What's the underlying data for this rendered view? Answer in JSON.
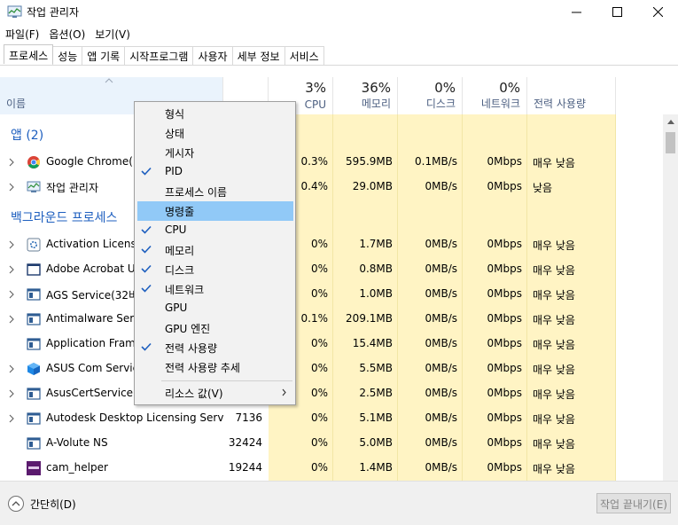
{
  "window": {
    "title": "작업 관리자"
  },
  "menu": [
    "파일(F)",
    "옵션(O)",
    "보기(V)"
  ],
  "tabs": [
    "프로세스",
    "성능",
    "앱 기록",
    "시작프로그램",
    "사용자",
    "세부 정보",
    "서비스"
  ],
  "columns": {
    "name": {
      "label": "이름"
    },
    "cpu": {
      "percent": "3%",
      "label": "CPU"
    },
    "memory": {
      "percent": "36%",
      "label": "메모리"
    },
    "disk": {
      "percent": "0%",
      "label": "디스크"
    },
    "network": {
      "percent": "0%",
      "label": "네트워크"
    },
    "power": {
      "label": "전력 사용량"
    }
  },
  "groups": {
    "apps": "앱 (2)",
    "background": "백그라운드 프로세스"
  },
  "rows": [
    {
      "name": "Google Chrome(14",
      "icon": "chrome-icon",
      "pid": "",
      "cpu": "0.3%",
      "mem": "595.9MB",
      "disk": "0.1MB/s",
      "net": "0Mbps",
      "power": "매우 낮음"
    },
    {
      "name": "작업 관리자",
      "icon": "task-manager-icon",
      "pid": "",
      "cpu": "0.4%",
      "mem": "29.0MB",
      "disk": "0MB/s",
      "net": "0Mbps",
      "power": "낮음"
    },
    {
      "name": "Activation Licensin",
      "icon": "gear-app-icon",
      "pid": "",
      "cpu": "0%",
      "mem": "1.7MB",
      "disk": "0MB/s",
      "net": "0Mbps",
      "power": "매우 낮음"
    },
    {
      "name": "Adobe Acrobat Up",
      "icon": "window-icon",
      "pid": "",
      "cpu": "0%",
      "mem": "0.8MB",
      "disk": "0MB/s",
      "net": "0Mbps",
      "power": "매우 낮음"
    },
    {
      "name": "AGS Service(32비트",
      "icon": "service-icon",
      "pid": "",
      "cpu": "0%",
      "mem": "1.0MB",
      "disk": "0MB/s",
      "net": "0Mbps",
      "power": "매우 낮음"
    },
    {
      "name": "Antimalware Servic",
      "icon": "service-icon",
      "pid": "",
      "cpu": "0.1%",
      "mem": "209.1MB",
      "disk": "0MB/s",
      "net": "0Mbps",
      "power": "매우 낮음"
    },
    {
      "name": "Application Frame",
      "icon": "service-icon",
      "pid": "",
      "cpu": "0%",
      "mem": "15.4MB",
      "disk": "0MB/s",
      "net": "0Mbps",
      "power": "매우 낮음"
    },
    {
      "name": "ASUS Com Service",
      "icon": "cube-icon",
      "pid": "",
      "cpu": "0%",
      "mem": "5.5MB",
      "disk": "0MB/s",
      "net": "0Mbps",
      "power": "매우 낮음"
    },
    {
      "name": "AsusCertService.ex",
      "icon": "service-icon",
      "pid": "",
      "cpu": "0%",
      "mem": "2.5MB",
      "disk": "0MB/s",
      "net": "0Mbps",
      "power": "매우 낮음"
    },
    {
      "name": "Autodesk Desktop Licensing Servi...",
      "icon": "service-icon",
      "pid": "7136",
      "cpu": "0%",
      "mem": "5.1MB",
      "disk": "0MB/s",
      "net": "0Mbps",
      "power": "매우 낮음"
    },
    {
      "name": "A-Volute NS",
      "icon": "service-icon",
      "pid": "32424",
      "cpu": "0%",
      "mem": "5.0MB",
      "disk": "0MB/s",
      "net": "0Mbps",
      "power": "매우 낮음"
    },
    {
      "name": "cam_helper",
      "icon": "nzxt-icon",
      "pid": "19244",
      "cpu": "0%",
      "mem": "1.4MB",
      "disk": "0MB/s",
      "net": "0Mbps",
      "power": "매우 낮음"
    }
  ],
  "context_menu": {
    "items": [
      {
        "label": "형식",
        "checked": false
      },
      {
        "label": "상태",
        "checked": false
      },
      {
        "label": "게시자",
        "checked": false
      },
      {
        "label": "PID",
        "checked": true
      },
      {
        "label": "프로세스 이름",
        "checked": false
      },
      {
        "label": "명령줄",
        "checked": false,
        "highlighted": true
      },
      {
        "label": "CPU",
        "checked": true
      },
      {
        "label": "메모리",
        "checked": true
      },
      {
        "label": "디스크",
        "checked": true
      },
      {
        "label": "네트워크",
        "checked": true
      },
      {
        "label": "GPU",
        "checked": false
      },
      {
        "label": "GPU 엔진",
        "checked": false
      },
      {
        "label": "전력 사용량",
        "checked": true
      },
      {
        "label": "전력 사용량 추세",
        "checked": false
      },
      {
        "label": "리소스 값(V)",
        "checked": false,
        "submenu": true
      }
    ]
  },
  "footer": {
    "collapse_label": "간단히(D)",
    "end_task_label": "작업 끝내기(E)"
  },
  "colors": {
    "accent": "#1e5fbf",
    "heat": "#fff4c4",
    "menu_highlight": "#91c9f7"
  }
}
